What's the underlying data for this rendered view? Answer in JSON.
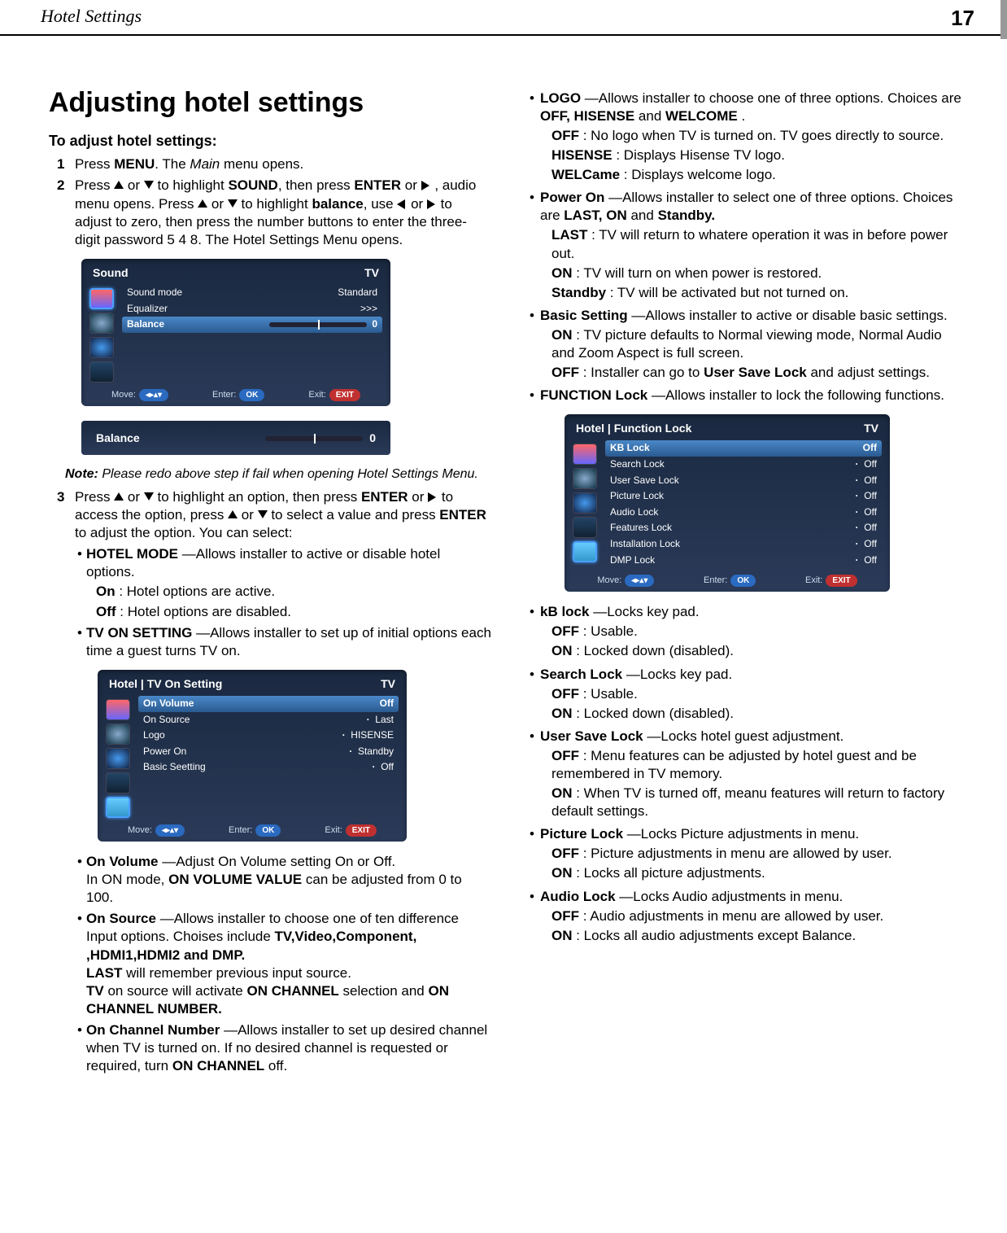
{
  "header": {
    "title": "Hotel Settings",
    "page": "17"
  },
  "h1": "Adjusting hotel settings",
  "intro": "To adjust hotel settings:",
  "step1": {
    "n": "1",
    "a": "Press ",
    "menu": "MENU",
    "b": ". The ",
    "main": "Main",
    "c": " menu opens."
  },
  "step2": {
    "n": "2",
    "a": "Press ",
    "b": " or ",
    "c": " to highlight ",
    "sound": "SOUND",
    "d": ", then press ",
    "enter": "ENTER",
    "e": " or ",
    "f": " , audio menu opens. Press ",
    "g": " or ",
    "h": " to highlight ",
    "balance": "balance",
    "i": ", use ",
    "j": " or ",
    "k": " to adjust to zero, then press the number buttons to enter the three-digit password 5 4 8. The Hotel Settings Menu opens."
  },
  "osd1": {
    "title": "Sound",
    "tv": "TV",
    "rows": [
      {
        "l": "Sound mode",
        "v": "Standard"
      },
      {
        "l": "Equalizer",
        "v": ">>>"
      },
      {
        "l": "Balance",
        "v": "0",
        "sel": true,
        "bar": true
      }
    ],
    "footer": {
      "move": "Move:",
      "enter": "Enter:",
      "ok": "OK",
      "exit": "Exit:",
      "exitb": "EXIT"
    }
  },
  "balancebar": {
    "label": "Balance",
    "val": "0"
  },
  "note": "Note:",
  "notetext": " Please redo above step if fail when opening Hotel Settings Menu.",
  "step3": {
    "n": "3",
    "a": "Press ",
    "b": " or ",
    "c": " to highlight an option, then press ",
    "enter": "ENTER",
    "d": " or ",
    "e": " to access the option, press ",
    "f": " or ",
    "g": " to select a value and press  ",
    "enter2": "ENTER",
    "h": " to adjust the option. You can select:"
  },
  "l_hm": {
    "t": "HOTEL MODE",
    "d": " —Allows installer to active or disable hotel options."
  },
  "l_hm_on": {
    "t": "On",
    "d": " : Hotel options are active."
  },
  "l_hm_off": {
    "t": "Off",
    "d": " : Hotel options are disabled."
  },
  "l_tvon": {
    "t": "TV ON SETTING",
    "d": " —Allows installer to set up of initial options each time a guest turns TV on."
  },
  "osd2": {
    "title": "Hotel | TV On Setting",
    "tv": "TV",
    "rows": [
      {
        "l": "On Volume",
        "v": "Off",
        "sel": true
      },
      {
        "l": "On Source",
        "v": "Last"
      },
      {
        "l": "Logo",
        "v": "HISENSE"
      },
      {
        "l": "Power On",
        "v": "Standby"
      },
      {
        "l": "Basic Seetting",
        "v": "Off"
      }
    ],
    "footer": {
      "move": "Move:",
      "enter": "Enter:",
      "ok": "OK",
      "exit": "Exit:",
      "exitb": "EXIT"
    }
  },
  "l_ov": {
    "t": "On Volume",
    "d": "   —Adjust On Volume setting On or Off."
  },
  "l_ov2a": "In ON mode, ",
  "l_ov2b": "ON VOLUME VALUE",
  "l_ov2c": "  can be adjusted  from 0 to 100.",
  "l_os": {
    "t": "On Source",
    "d": "   —Allows installer to choose one of ten difference Input options. Choises include "
  },
  "l_os_b": "TV,Video,Component, ,HDMI1,HDMI2 and DMP.",
  "l_os_last": {
    "t": "LAST",
    "d": " will remember previous input source."
  },
  "l_os_tv": {
    "t": "TV",
    "d": " on source will activate ",
    "t2": " ON CHANNEL",
    "d2": " selection and ",
    "t3": "ON CHANNEL NUMBER."
  },
  "l_ocn": {
    "t": "On Channel Number",
    "d": "   —Allows installer to set up desired channel when TV is turned on. If no desired channel is requested or required, turn ",
    "t2": "ON CHANNEL",
    "d2": " off."
  },
  "r_logo": {
    "t": "LOGO",
    "d": "  —Allows installer to choose one of three options. Choices are ",
    "t2": "OFF, HISENSE",
    "d2": "  and ",
    "t3": "WELCOME",
    "d3": "  ."
  },
  "r_logo_off": {
    "t": "OFF",
    "d": " : No logo when TV is turned on. TV goes directly to source."
  },
  "r_logo_h": {
    "t": "HISENSE",
    "d": " : Displays Hisense TV logo."
  },
  "r_logo_w": {
    "t": "WELCame",
    "d": " : Displays welcome logo."
  },
  "r_po": {
    "t": "Power On",
    "d": "  —Allows installer to select one of three options. Choices are ",
    "t2": "LAST, ON",
    "d2": "  and ",
    "t3": "Standby."
  },
  "r_po_last": {
    "t": "LAST",
    "d": " : TV will return to whatere operation it was in before power out."
  },
  "r_po_on": {
    "t": "ON",
    "d": " : TV will turn on when power is restored."
  },
  "r_po_sb": {
    "t": "Standby",
    "d": " : TV will be activated but not turned on."
  },
  "r_bs": {
    "t": "Basic Setting",
    "d": "  —Allows installer to active or disable basic settings."
  },
  "r_bs_on": {
    "t": "ON",
    "d": " : TV picture defaults to Normal viewing mode, Normal Audio and Zoom Aspect is full screen."
  },
  "r_bs_off": {
    "t": "OFF",
    "d": "  : Installer can go to ",
    "t2": "User Save Lock",
    "d2": "   and adjust settings."
  },
  "r_fl": {
    "t": "FUNCTION Lock",
    "d": " —Allows installer to lock the following functions."
  },
  "osd3": {
    "title": "Hotel | Function Lock",
    "tv": "TV",
    "rows": [
      {
        "l": "KB Lock",
        "v": "Off",
        "sel": true
      },
      {
        "l": "Search Lock",
        "v": "Off"
      },
      {
        "l": "User Save Lock",
        "v": "Off"
      },
      {
        "l": "Picture Lock",
        "v": "Off"
      },
      {
        "l": "Audio Lock",
        "v": "Off"
      },
      {
        "l": "Features Lock",
        "v": "Off"
      },
      {
        "l": "Installation Lock",
        "v": "Off"
      },
      {
        "l": "DMP Lock",
        "v": "Off"
      }
    ],
    "footer": {
      "move": "Move:",
      "enter": "Enter:",
      "ok": "OK",
      "exit": "Exit:",
      "exitb": "EXIT"
    }
  },
  "r_kb": {
    "t": "kB lock",
    "d": " —Locks key pad."
  },
  "r_kb_off": {
    "t": "OFF",
    "d": " : Usable."
  },
  "r_kb_on": {
    "t": "ON",
    "d": "  : Locked down (disabled)."
  },
  "r_sl": {
    "t": "Search Lock",
    "d": "  —Locks key pad."
  },
  "r_sl_off": {
    "t": "OFF",
    "d": " : Usable."
  },
  "r_sl_on": {
    "t": "ON",
    "d": "  : Locked down (disabled)."
  },
  "r_usl": {
    "t": "User Save Lock",
    "d": " —Locks hotel guest adjustment."
  },
  "r_usl_off": {
    "t": "OFF",
    "d": " : Menu features can be adjusted by hotel guest and be remembered in TV memory."
  },
  "r_usl_on": {
    "t": "ON",
    "d": " : When TV is turned off, meanu features will return to factory default settings."
  },
  "r_pl": {
    "t": "Picture Lock",
    "d": " —Locks Picture adjustments in menu."
  },
  "r_pl_off": {
    "t": "OFF",
    "d": " : Picture adjustments in menu are allowed by user."
  },
  "r_pl_on": {
    "t": "ON",
    "d": " : Locks all picture adjustments."
  },
  "r_al": {
    "t": "Audio Lock",
    "d": "   —Locks Audio adjustments in menu."
  },
  "r_al_off": {
    "t": "OFF",
    "d": " : Audio adjustments in menu are allowed by user."
  },
  "r_al_on": {
    "t": "ON",
    "d": " : Locks all audio adjustments except Balance."
  }
}
